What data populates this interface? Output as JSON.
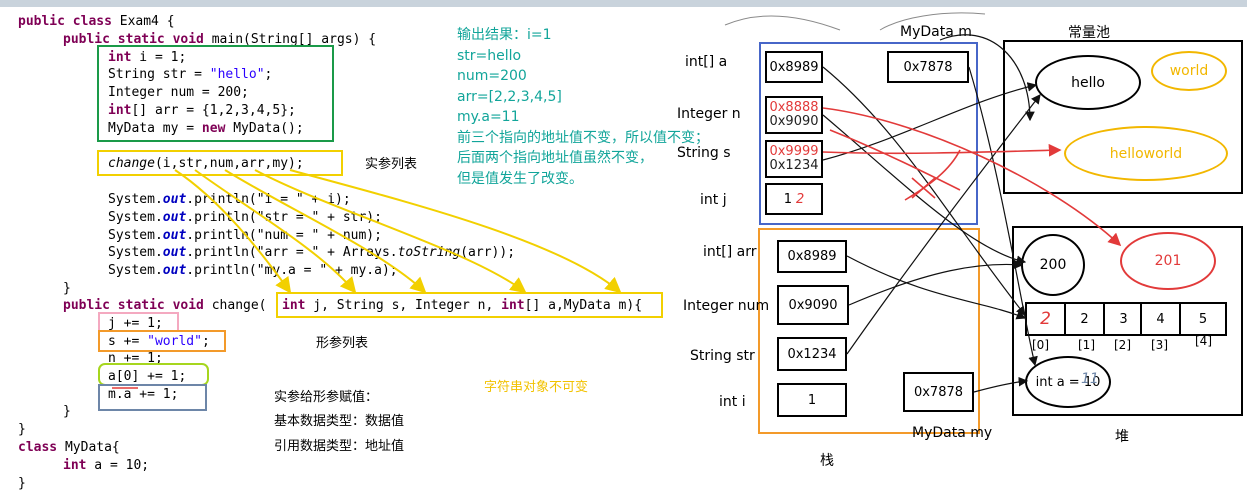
{
  "code": {
    "l1": {
      "kw": "public class",
      "rest": " Exam4 {"
    },
    "l2": {
      "kw": "public static void",
      "rest": " main(String[] args) {"
    },
    "l3": {
      "kw": "int",
      "rest": " i = 1;"
    },
    "l4": {
      "pre": "String str = ",
      "str": "\"hello\"",
      "post": ";"
    },
    "l5": "Integer num = 200;",
    "l6": {
      "kw": "int",
      "rest": "[] arr = {1,2,3,4,5};"
    },
    "l7": {
      "pre": "MyData my = ",
      "kw": "new",
      "post": " MyData();"
    },
    "l8": {
      "call": "change",
      "rest": "(i,str,num,arr,my);"
    },
    "l9": {
      "pre": "System.",
      "fld": "out",
      "post": ".println(\"i = \" + i);"
    },
    "l10": {
      "pre": "System.",
      "fld": "out",
      "post": ".println(\"str = \" + str);"
    },
    "l11": {
      "pre": "System.",
      "fld": "out",
      "post": ".println(\"num = \" + num);"
    },
    "l12": {
      "pre": "System.",
      "fld": "out",
      "mid": ".println(\"arr = \" + Arrays.",
      "call": "toString",
      "post": "(arr));"
    },
    "l13": {
      "pre": "System.",
      "fld": "out",
      "post": ".println(\"my.a = \" + my.a);"
    },
    "l14": "}",
    "l15": {
      "kw": "public static void",
      "rest": " change("
    },
    "l15b": {
      "kw1": "int",
      "r1": " j, String s, Integer n, ",
      "kw2": "int",
      "r2": "[] a,MyData m){"
    },
    "l16": "j += 1;",
    "l17": {
      "pre": "s += ",
      "str": "\"world\"",
      "post": ";"
    },
    "l18": "n += 1;",
    "l19": "a[0] += 1;",
    "l20": "m.a += 1;",
    "l21": "}",
    "l22": "}",
    "l23": {
      "kw": "class",
      "rest": " MyData{"
    },
    "l24": {
      "kw": "int",
      "rest": " a = 10;"
    },
    "l25": "}"
  },
  "notes": {
    "actual_params": "实参列表",
    "formal_params": "形参列表",
    "assign_title": "实参给形参赋值：",
    "assign_basic": "基本数据类型：数据值",
    "assign_ref": "引用数据类型：地址值",
    "string_immutable": "字符串对象不可变"
  },
  "output": [
    "输出结果：i=1",
    "str=hello",
    "num=200",
    "arr=[2,2,3,4,5]",
    "my.a=11",
    "前三个指向的地址值不变，所以值不变；",
    "后面两个指向地址值虽然不变，",
    "但是值发生了改变。"
  ],
  "memory": {
    "change_frame": {
      "title": "MyData m",
      "int_arr_a": {
        "label": "int[]  a",
        "value": "0x8989"
      },
      "m_value": "0x7878",
      "integer_n": {
        "label": "Integer n",
        "value": "0x8888",
        "overwritten": "0x9090"
      },
      "string_s": {
        "label": "String  s",
        "value": "0x1234",
        "overwritten": "0x9999"
      },
      "int_j": {
        "label": "int  j",
        "value": "1",
        "scribble": "2"
      }
    },
    "main_frame": {
      "int_arr": {
        "label": "int[]   arr",
        "value": "0x8989"
      },
      "integer_num": {
        "label": "Integer num",
        "value": "0x9090"
      },
      "string_str": {
        "label": "String str",
        "value": "0x1234"
      },
      "int_i": {
        "label": "int  i",
        "value": "1"
      },
      "my_value": "0x7878",
      "my_label": "MyData my",
      "stack_label": "栈"
    },
    "constant_pool": {
      "title": "常量池",
      "hello": "hello",
      "world": "world",
      "helloworld": "helloworld"
    },
    "heap": {
      "title": "堆",
      "num200": "200",
      "num201": "201",
      "array_values": [
        "2",
        "2",
        "3",
        "4",
        "5"
      ],
      "array_scribble": "2",
      "array_indices": [
        "[0]",
        "[1]",
        "[2]",
        "[3]",
        "[4]"
      ],
      "int_a": "int a = 10",
      "int_a_scribble": "11"
    }
  },
  "colors": {
    "green": "#1a9a48",
    "yellow": "#f2d000",
    "pink": "#f4a9c0",
    "orange_box": "#f39a2a",
    "blue_box": "#4766c8",
    "teal": "#12a59a",
    "red": "#e23a3a",
    "gold": "#f2b700",
    "slate": "#6d86a8"
  }
}
